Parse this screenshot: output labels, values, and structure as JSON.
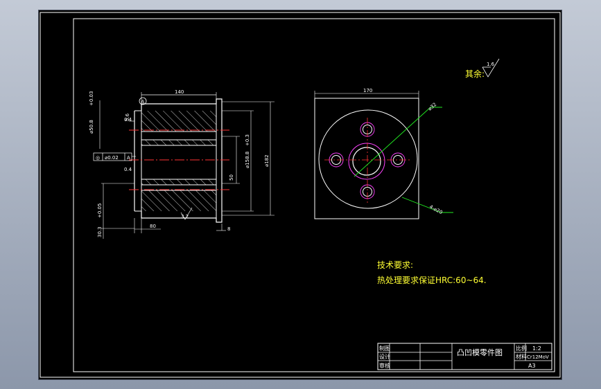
{
  "drawing": {
    "roughness_label": "其余:",
    "roughness_value": "1.6",
    "tech_title": "技术要求:",
    "tech_line": "热处理要求保证HRC:60~64.",
    "datum_a": "A",
    "front_view": {
      "dim_length": "140",
      "dim_d_top": "⌀50.8",
      "dim_d_top_tol": "+0.03",
      "dim_small": "5.6",
      "dim_d_main": "⌀158.8",
      "dim_d_main_tol": "+0.3",
      "dim_d_outer": "⌀182",
      "dim_50": "50",
      "dim_8": "8",
      "dim_80": "80",
      "dim_bottom": "30.3",
      "dim_bottom_tol": "+0.05",
      "roughness_04_a": "0.4",
      "roughness_04_b": "0.4",
      "roughness_32": "3.2",
      "fcf_symbol": "◎",
      "fcf_value": "⌀0.02",
      "fcf_datum": "A"
    },
    "side_view": {
      "dim_width": "170",
      "dim_hole": "⌀32",
      "dim_holes": "4-⌀20"
    }
  },
  "title_block": {
    "drawing_name": "凸凹模零件图",
    "ratio_label": "比例",
    "ratio_value": "1:2",
    "material_label": "材料",
    "material_value": "Cr12MoV",
    "size_value": "A3",
    "drawn_label": "制图",
    "design_label": "设计",
    "check_label": "审核"
  },
  "colors": {
    "frame": "#ffffff",
    "centerline": "#ff3333",
    "hidden": "#ff44ff",
    "leader": "#22ee22",
    "annotation": "#ffff33"
  }
}
